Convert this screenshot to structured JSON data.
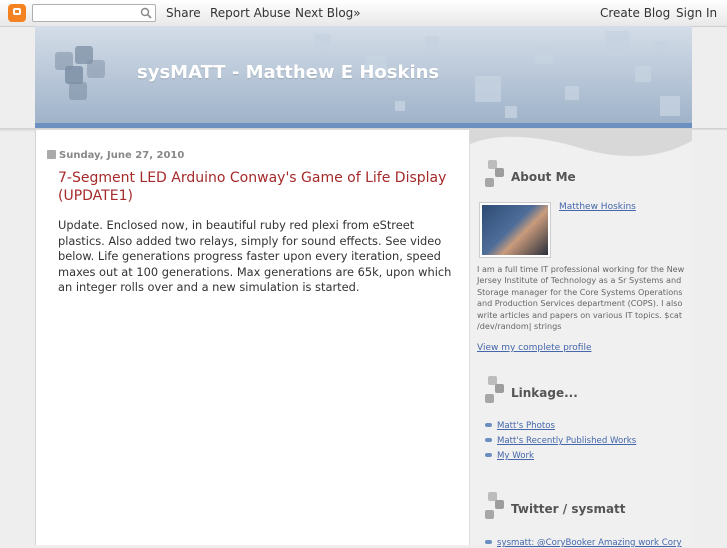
{
  "navbar": {
    "search_placeholder": "",
    "share": "Share",
    "report_abuse": "Report Abuse",
    "next_blog": "Next Blog»",
    "create_blog": "Create Blog",
    "sign_in": "Sign In"
  },
  "header": {
    "title": "sysMATT - Matthew E Hoskins"
  },
  "post": {
    "date": "Sunday, June 27, 2010",
    "title": "7-Segment LED Arduino Conway's Game of Life Display (UPDATE1)",
    "body": "Update.  Enclosed now, in beautiful ruby red plexi from eStreet plastics.  Also added two relays, simply for sound effects.  See video below.  Life generations progress faster upon every iteration, speed maxes out at 100 generations.   Max generations are 65k, upon which an integer rolls over and a new simulation is started."
  },
  "sidebar": {
    "about": {
      "title": "About Me",
      "name": "Matthew Hoskins",
      "text": "I am a full time IT professional working for the New Jersey Institute of Technology as a Sr Systems and Storage manager for the Core Systems Operations and Production Services department (COPS). I also write articles and papers on various IT topics. $cat /dev/random| strings",
      "profile_link": "View my complete profile"
    },
    "linkage": {
      "title": "Linkage...",
      "items": [
        "Matt's Photos",
        "Matt's Recently Published Works",
        "My Work"
      ]
    },
    "twitter": {
      "title": "Twitter / sysmatt",
      "first_item": "sysmatt: @CoryBooker Amazing work Cory"
    }
  },
  "colors": {
    "post_title": "#a52a2a",
    "link": "#4466aa",
    "header_stripe": "#6c90c0",
    "blogger_logo": "#f58220"
  }
}
